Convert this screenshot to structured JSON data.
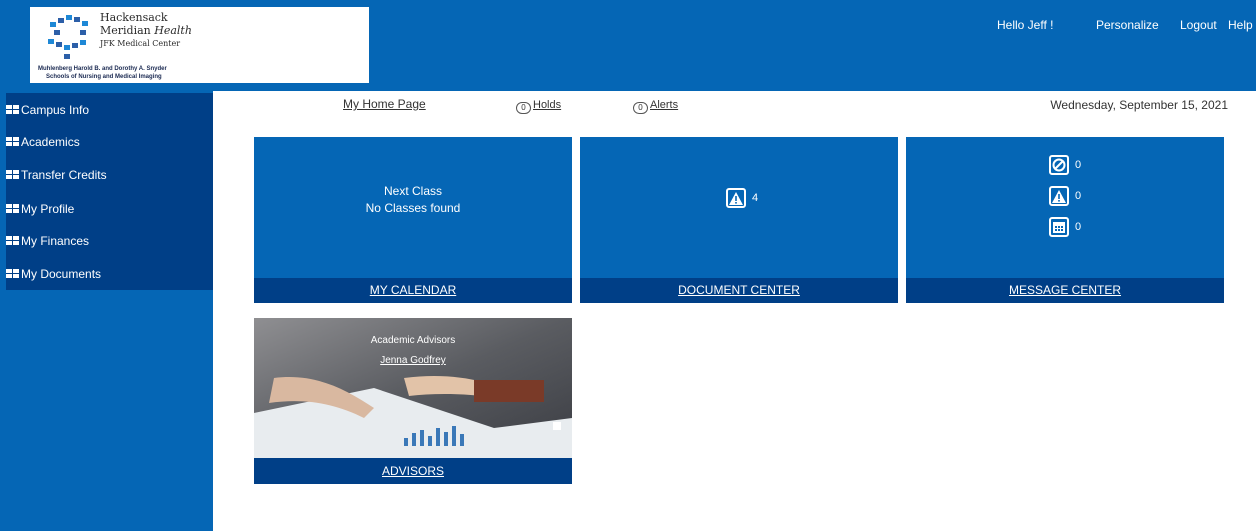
{
  "logo": {
    "line1": "Hackensack",
    "line2_a": "Meridian ",
    "line2_b": "Health",
    "line3": "JFK Medical Center",
    "sub1": "Muhlenberg Harold B. and Dorothy A. Snyder",
    "sub2": "Schools of Nursing and Medical Imaging"
  },
  "header": {
    "greeting": "Hello Jeff !",
    "personalize": "Personalize",
    "logout": "Logout",
    "help": "Help"
  },
  "sidebar": {
    "items": [
      {
        "label": "Campus Info"
      },
      {
        "label": "Academics"
      },
      {
        "label": "Transfer Credits"
      },
      {
        "label": "My Profile"
      },
      {
        "label": "My Finances"
      },
      {
        "label": "My Documents"
      }
    ]
  },
  "subnav": {
    "home": "My Home Page",
    "holds_count": "0",
    "holds": "Holds",
    "alerts_count": "0",
    "alerts": "Alerts",
    "date": "Wednesday, September 15, 2021"
  },
  "tiles": {
    "calendar": {
      "line1": "Next Class",
      "line2": "No Classes found",
      "footer": "MY CALENDAR"
    },
    "documents": {
      "count": "4",
      "footer": "DOCUMENT CENTER"
    },
    "messages": {
      "blocked_count": "0",
      "alert_count": "0",
      "calendar_count": "0",
      "footer": "MESSAGE CENTER"
    },
    "advisors": {
      "heading": "Academic Advisors",
      "name": "Jenna Godfrey",
      "footer": "ADVISORS"
    }
  },
  "colors": {
    "brand_blue": "#0566b5",
    "dark_blue": "#003f87"
  }
}
